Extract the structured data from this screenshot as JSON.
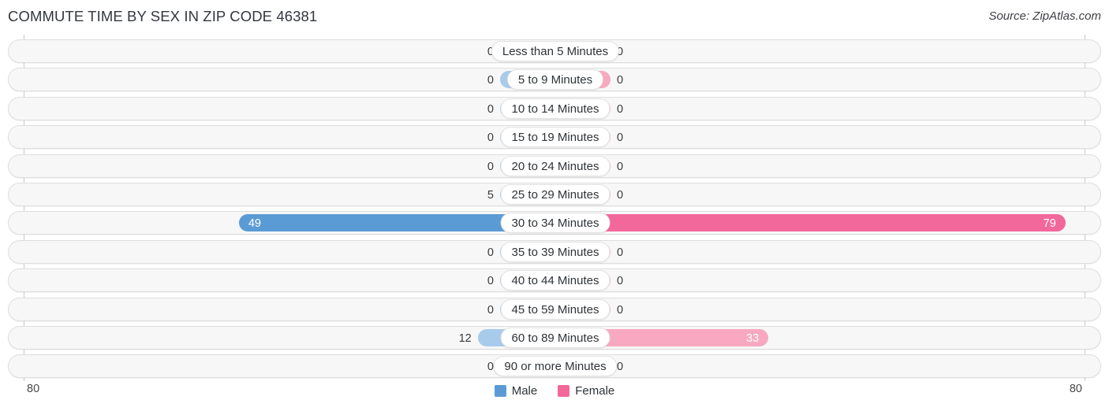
{
  "header": {
    "title": "COMMUTE TIME BY SEX IN ZIP CODE 46381",
    "source": "Source: ZipAtlas.com"
  },
  "legend": {
    "male_label": "Male",
    "female_label": "Female",
    "male_color": "#5b9bd5",
    "female_color": "#f2689a"
  },
  "axis": {
    "left_max_label": "80",
    "right_max_label": "80"
  },
  "colors": {
    "male_dim": "#a8cbeb",
    "female_dim": "#f8a8c0",
    "male_strong": "#5b9bd5",
    "female_strong": "#f2689a",
    "track": "#f7f7f7",
    "track_border": "#dedede"
  },
  "chart_data": {
    "type": "bar",
    "title": "COMMUTE TIME BY SEX IN ZIP CODE 46381",
    "orientation": "horizontal-diverging",
    "xlabel": "",
    "ylabel": "",
    "xlim": [
      80,
      80
    ],
    "grid": false,
    "legend_position": "bottom-center",
    "categories": [
      "Less than 5 Minutes",
      "5 to 9 Minutes",
      "10 to 14 Minutes",
      "15 to 19 Minutes",
      "20 to 24 Minutes",
      "25 to 29 Minutes",
      "30 to 34 Minutes",
      "35 to 39 Minutes",
      "40 to 44 Minutes",
      "45 to 59 Minutes",
      "60 to 89 Minutes",
      "90 or more Minutes"
    ],
    "series": [
      {
        "name": "Male",
        "values": [
          0,
          0,
          0,
          0,
          0,
          5,
          49,
          0,
          0,
          0,
          12,
          0
        ]
      },
      {
        "name": "Female",
        "values": [
          0,
          0,
          0,
          0,
          0,
          0,
          79,
          0,
          0,
          0,
          33,
          0
        ]
      }
    ]
  },
  "rows": [
    {
      "category": "Less than 5 Minutes",
      "male": "0",
      "female": "0"
    },
    {
      "category": "5 to 9 Minutes",
      "male": "0",
      "female": "0"
    },
    {
      "category": "10 to 14 Minutes",
      "male": "0",
      "female": "0"
    },
    {
      "category": "15 to 19 Minutes",
      "male": "0",
      "female": "0"
    },
    {
      "category": "20 to 24 Minutes",
      "male": "0",
      "female": "0"
    },
    {
      "category": "25 to 29 Minutes",
      "male": "5",
      "female": "0"
    },
    {
      "category": "30 to 34 Minutes",
      "male": "49",
      "female": "79"
    },
    {
      "category": "35 to 39 Minutes",
      "male": "0",
      "female": "0"
    },
    {
      "category": "40 to 44 Minutes",
      "male": "0",
      "female": "0"
    },
    {
      "category": "45 to 59 Minutes",
      "male": "0",
      "female": "0"
    },
    {
      "category": "60 to 89 Minutes",
      "male": "12",
      "female": "33"
    },
    {
      "category": "90 or more Minutes",
      "male": "0",
      "female": "0"
    }
  ]
}
